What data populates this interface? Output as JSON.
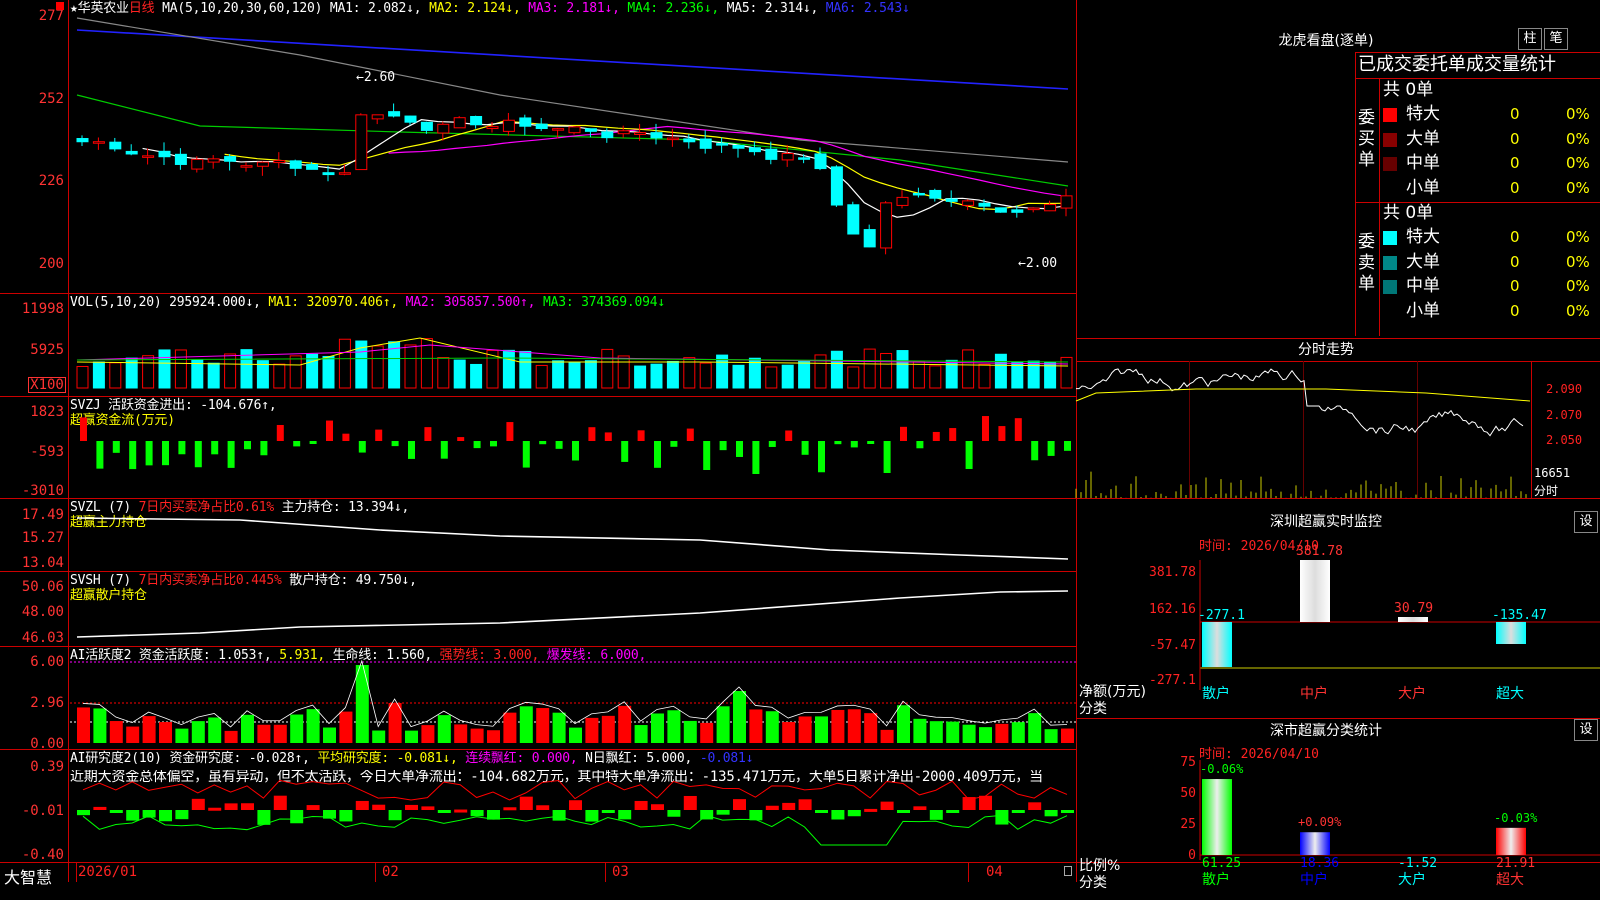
{
  "stock": {
    "star": "★",
    "name": "华英农业",
    "period": "日线"
  },
  "ma_header": {
    "label": "MA(5,10,20,30,60,120)",
    "ma1": "MA1: 2.082↓,",
    "ma2": "MA2: 2.124↓,",
    "ma3": "MA3: 2.181↓,",
    "ma4": "MA4: 2.236↓,",
    "ma5": "MA5: 2.314↓,",
    "ma6": "MA6: 2.543↓"
  },
  "price_axis": [
    "277",
    "252",
    "226",
    "200"
  ],
  "price_annotations": {
    "high": "←2.60",
    "low": "←2.00"
  },
  "vol_header": {
    "label": "VOL(5,10,20)",
    "value": "295924.000↓,",
    "ma1": "MA1: 320970.406↑,",
    "ma2": "MA2: 305857.500↑,",
    "ma3": "MA3: 374369.094↓"
  },
  "vol_axis": [
    "11998",
    "5925",
    "X100"
  ],
  "svzj": {
    "label": "SVZJ",
    "active": "活跃资金进出: -104.676↑,",
    "sub": "超赢资金流(万元)",
    "axis": [
      "1823",
      "-593",
      "-3010"
    ]
  },
  "svzl": {
    "label": "SVZL (7)",
    "ratio": "7日内买卖净占比0.61%",
    "hold": "主力持仓: 13.394↓,",
    "sub": "超赢主力持仓",
    "axis": [
      "17.49",
      "15.27",
      "13.04"
    ]
  },
  "svsh": {
    "label": "SVSH (7)",
    "ratio": "7日内买卖净占比0.445%",
    "hold": "散户持仓: 49.750↓,",
    "sub": "超赢散户持仓",
    "axis": [
      "50.06",
      "48.00",
      "46.03"
    ]
  },
  "ai_active": {
    "label": "AI活跃度2",
    "act": "资金活跃度: 1.053↑,",
    "v2": "5.931,",
    "life": "生命线: 1.560,",
    "strong": "强势线: 3.000,",
    "burst": "爆发线: 6.000,",
    "axis": [
      "6.00",
      "2.96",
      "0.00"
    ]
  },
  "ai_research": {
    "label": "AI研究度2(10)",
    "res": "资金研究度: -0.028↑,",
    "avg": "平均研究度: -0.081↓,",
    "cont": "连续飘红: 0.000,",
    "nday": "N日飘红: 5.000,",
    "v5": "-0.081↓",
    "axis": [
      "0.39",
      "-0.01",
      "-0.40"
    ],
    "comment": "近期大资金总体偏空，虽有异动，但不太活跃，今日大单净流出：-104.682万元，其中特大单净流出：-135.471万元，大单5日累计净出-2000.409万元，当"
  },
  "xaxis": {
    "brand": "大智慧",
    "d1": "2026/01",
    "d2": "02",
    "d3": "03",
    "d4": "04"
  },
  "longhu": {
    "title": "龙虎看盘(逐单)",
    "btn1": "柱",
    "btn2": "笔",
    "heading": "已成交委托单成交量统计",
    "buy": {
      "side": "委买单",
      "total": "共 0单",
      "rows": [
        {
          "name": "特大",
          "count": "0",
          "pct": "0%",
          "color": "#f00"
        },
        {
          "name": "大单",
          "count": "0",
          "pct": "0%",
          "color": "#800"
        },
        {
          "name": "中单",
          "count": "0",
          "pct": "0%",
          "color": "#600"
        },
        {
          "name": "小单",
          "count": "0",
          "pct": "0%",
          "color": "#000"
        }
      ]
    },
    "sell": {
      "side": "委卖单",
      "total": "共 0单",
      "rows": [
        {
          "name": "特大",
          "count": "0",
          "pct": "0%",
          "color": "#0ff"
        },
        {
          "name": "大单",
          "count": "0",
          "pct": "0%",
          "color": "#088"
        },
        {
          "name": "中单",
          "count": "0",
          "pct": "0%",
          "color": "#077"
        },
        {
          "name": "小单",
          "count": "0",
          "pct": "0%",
          "color": "#000"
        }
      ]
    }
  },
  "intraday": {
    "title": "分时走势",
    "axis": [
      "2.090",
      "2.070",
      "2.050"
    ],
    "vol": "16651",
    "unit": "分时"
  },
  "sz_monitor": {
    "title": "深圳超赢实时监控",
    "btn": "设",
    "time": "时间: 2026/04/10",
    "axis": [
      "381.78",
      "162.16",
      "-57.47",
      "-277.1"
    ],
    "ylabel": "净额(万元)",
    "xlabel": "分类",
    "bars": [
      {
        "name": "散户",
        "value": "-277.1",
        "num": -277.1
      },
      {
        "name": "中户",
        "value": "381.78",
        "num": 381.78
      },
      {
        "name": "大户",
        "value": "30.79",
        "num": 30.79
      },
      {
        "name": "超大",
        "value": "-135.47",
        "num": -135.47
      }
    ]
  },
  "sz_class": {
    "title": "深市超赢分类统计",
    "btn": "设",
    "time": "时间: 2026/04/10",
    "axis": [
      "75",
      "50",
      "25",
      "0"
    ],
    "ylabel": "比例%",
    "xlabel": "分类",
    "bars": [
      {
        "name": "散户",
        "top": "-0.06%",
        "value": "61.25",
        "num": 61.25
      },
      {
        "name": "中户",
        "top": "+0.09%",
        "value": "18.36",
        "num": 18.36
      },
      {
        "name": "大户",
        "top": "",
        "value": "-1.52",
        "num": -1.52
      },
      {
        "name": "超大",
        "top": "-0.03%",
        "value": "21.91",
        "num": 21.91
      }
    ]
  }
}
